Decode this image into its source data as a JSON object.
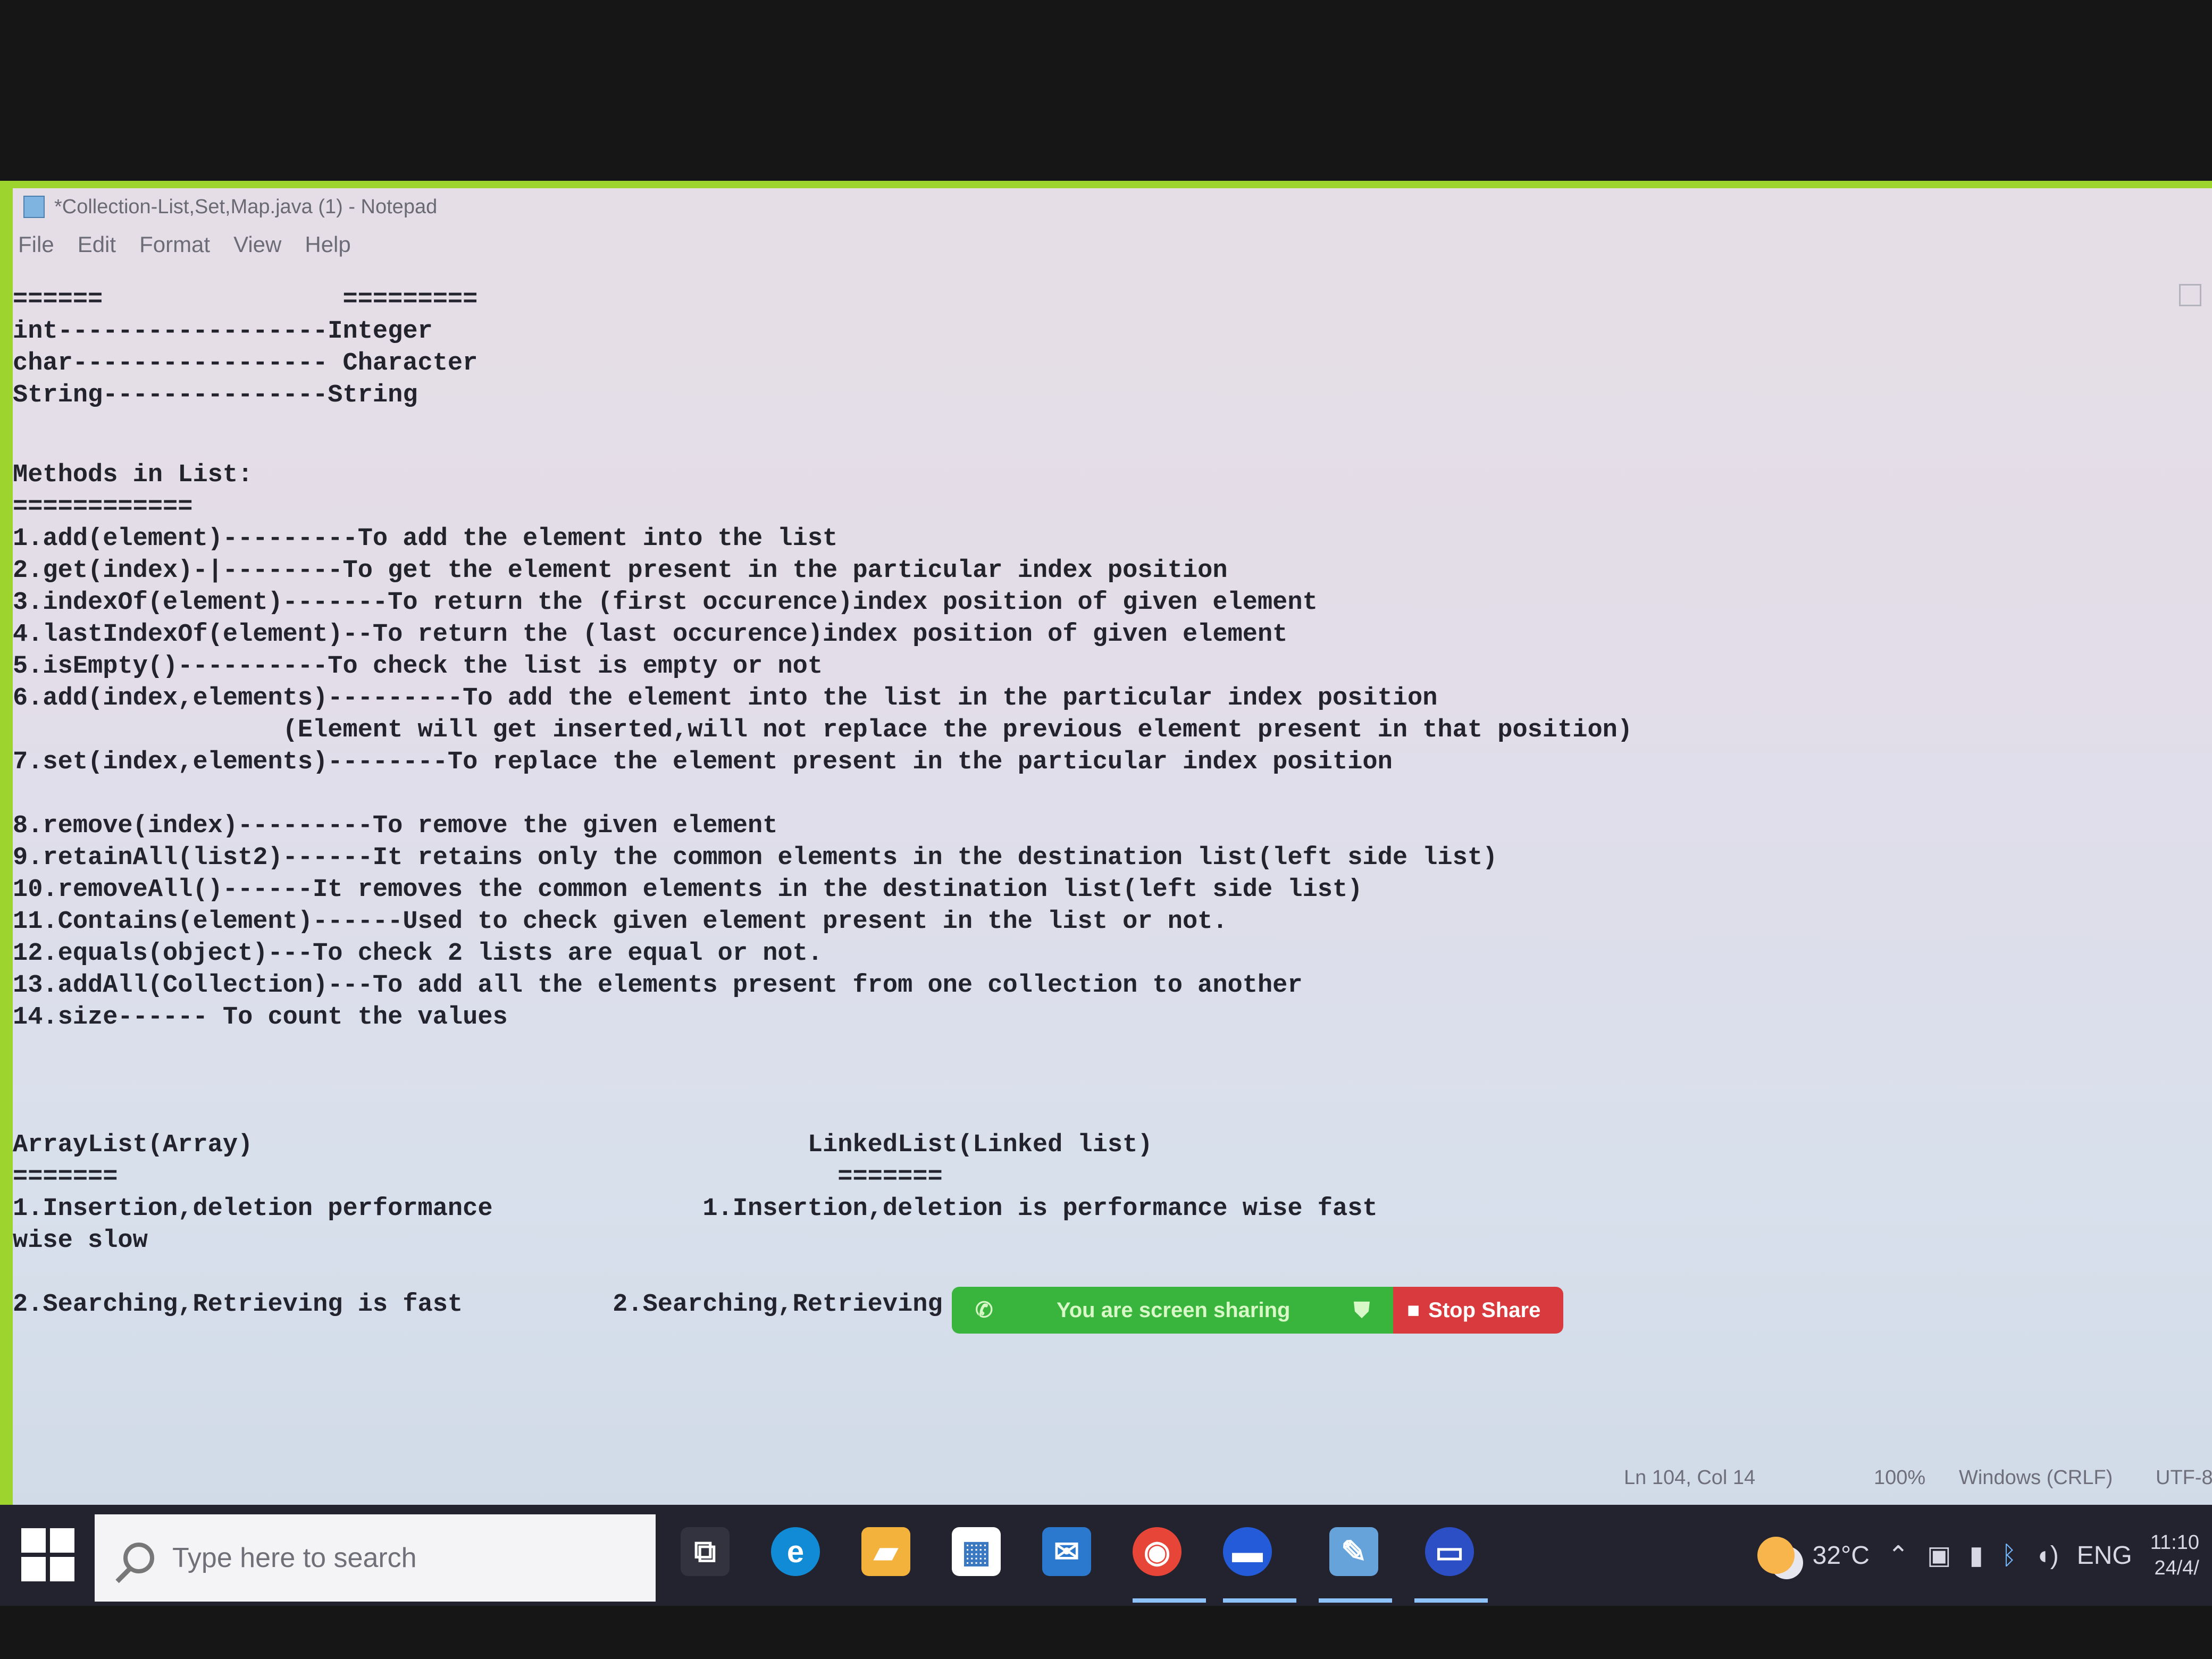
{
  "window": {
    "title": "*Collection-List,Set,Map.java (1) - Notepad",
    "menu": [
      "File",
      "Edit",
      "Format",
      "View",
      "Help"
    ]
  },
  "editor": {
    "lines": [
      "======                =========",
      "int------------------Integer",
      "char----------------- Character",
      "String---------------String",
      "",
      "Methods in List:",
      "============",
      "1.add(element)---------To add the element into the list",
      "2.get(index)-|--------To get the element present in the particular index position",
      "3.indexOf(element)-------To return the (first occurence)index position of given element",
      "4.lastIndexOf(element)--To return the (last occurence)index position of given element",
      "5.isEmpty()----------To check the list is empty or not",
      "6.add(index,elements)---------To add the element into the list in the particular index position",
      "                  (Element will get inserted,will not replace the previous element present in that position)",
      "7.set(index,elements)--------To replace the element present in the particular index position",
      "",
      "8.remove(index)---------To remove the given element",
      "9.retainAll(list2)------It retains only the common elements in the destination list(left side list)",
      "10.removeAll()------It removes the common elements in the destination list(left side list)",
      "11.Contains(element)------Used to check given element present in the list or not.",
      "12.equals(object)---To check 2 lists are equal or not.",
      "13.addAll(Collection)---To add all the elements present from one collection to another",
      "14.size------ To count the values",
      "",
      "",
      "",
      "ArrayList(Array)                                     LinkedList(Linked list)",
      "=======                                                =======",
      "1.Insertion,deletion performance              1.Insertion,deletion is performance wise fast",
      "wise slow",
      "",
      "2.Searching,Retrieving is fast          2.Searching,Retrieving is slow"
    ]
  },
  "screen_share": {
    "status": "You are screen sharing",
    "stop_label": "Stop Share"
  },
  "statusbar": {
    "position": "Ln 104, Col 14",
    "zoom": "100%",
    "line_ending": "Windows (CRLF)",
    "encoding": "UTF-8"
  },
  "taskbar": {
    "search_placeholder": "Type here to search",
    "apps": [
      "task-view",
      "edge",
      "file-explorer",
      "store",
      "mail",
      "chrome",
      "zoom",
      "notepad",
      "flag-app"
    ],
    "temperature": "32°C",
    "language": "ENG",
    "time": "11:10",
    "date": "24/4/"
  }
}
